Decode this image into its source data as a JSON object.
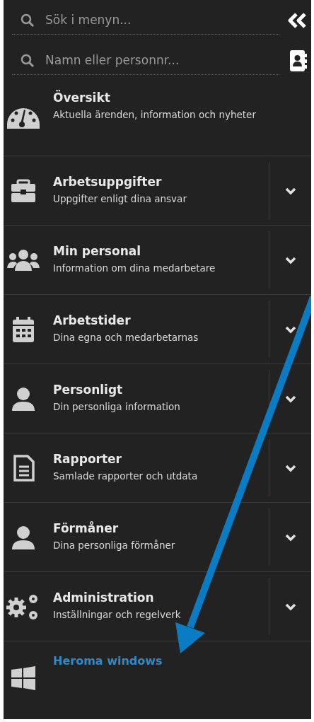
{
  "search_fields": [
    {
      "placeholder": "Sök i menyn..."
    },
    {
      "placeholder": "Namn eller personnr..."
    }
  ],
  "menu": [
    {
      "kind": "plain",
      "title": "Översikt",
      "subtitle": "Aktuella ärenden, information och nyheter"
    },
    {
      "kind": "expandable",
      "title": "Arbetsuppgifter",
      "subtitle": "Uppgifter enligt dina ansvar"
    },
    {
      "kind": "expandable",
      "title": "Min personal",
      "subtitle": "Information om dina medarbetare"
    },
    {
      "kind": "expandable",
      "title": "Arbetstider",
      "subtitle": "Dina egna och medarbetarnas"
    },
    {
      "kind": "expandable",
      "title": "Personligt",
      "subtitle": "Din personliga information"
    },
    {
      "kind": "expandable",
      "title": "Rapporter",
      "subtitle": "Samlade rapporter och utdata"
    },
    {
      "kind": "expandable",
      "title": "Förmåner",
      "subtitle": "Dina personliga förmåner"
    },
    {
      "kind": "expandable",
      "title": "Administration",
      "subtitle": "Inställningar och regelverk"
    },
    {
      "kind": "link",
      "title": "Heroma windows"
    }
  ]
}
